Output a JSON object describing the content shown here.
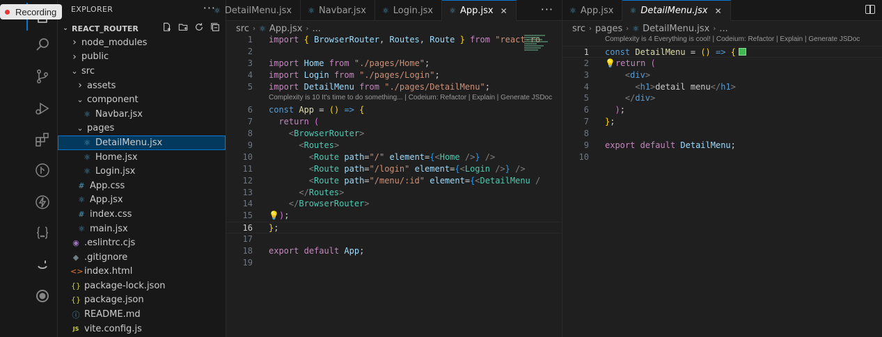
{
  "recording": {
    "label": "Recording"
  },
  "sidebar": {
    "title": "EXPLORER",
    "more": "···",
    "root": "REACT_ROUTER",
    "tree": [
      {
        "label": "node_modules",
        "kind": "folder",
        "depth": 0,
        "open": false,
        "icon": "chevron-right-icon"
      },
      {
        "label": "public",
        "kind": "folder",
        "depth": 0,
        "open": false,
        "icon": "chevron-right-icon"
      },
      {
        "label": "src",
        "kind": "folder",
        "depth": 0,
        "open": true,
        "icon": "chevron-down-icon"
      },
      {
        "label": "assets",
        "kind": "folder",
        "depth": 1,
        "open": false,
        "icon": "chevron-right-icon"
      },
      {
        "label": "component",
        "kind": "folder",
        "depth": 1,
        "open": true,
        "icon": "chevron-down-icon"
      },
      {
        "label": "Navbar.jsx",
        "kind": "file",
        "depth": 2,
        "icon": "react-icon"
      },
      {
        "label": "pages",
        "kind": "folder",
        "depth": 1,
        "open": true,
        "icon": "chevron-down-icon"
      },
      {
        "label": "DetailMenu.jsx",
        "kind": "file",
        "depth": 2,
        "icon": "react-icon",
        "selected": true
      },
      {
        "label": "Home.jsx",
        "kind": "file",
        "depth": 2,
        "icon": "react-icon"
      },
      {
        "label": "Login.jsx",
        "kind": "file",
        "depth": 2,
        "icon": "react-icon"
      },
      {
        "label": "App.css",
        "kind": "file",
        "depth": 1,
        "icon": "css-hash-icon"
      },
      {
        "label": "App.jsx",
        "kind": "file",
        "depth": 1,
        "icon": "react-icon"
      },
      {
        "label": "index.css",
        "kind": "file",
        "depth": 1,
        "icon": "css-hash-icon"
      },
      {
        "label": "main.jsx",
        "kind": "file",
        "depth": 1,
        "icon": "react-icon"
      },
      {
        "label": ".eslintrc.cjs",
        "kind": "file",
        "depth": 0,
        "icon": "eslint-icon"
      },
      {
        "label": ".gitignore",
        "kind": "file",
        "depth": 0,
        "icon": "git-icon"
      },
      {
        "label": "index.html",
        "kind": "file",
        "depth": 0,
        "icon": "html-icon"
      },
      {
        "label": "package-lock.json",
        "kind": "file",
        "depth": 0,
        "icon": "json-icon"
      },
      {
        "label": "package.json",
        "kind": "file",
        "depth": 0,
        "icon": "json-icon"
      },
      {
        "label": "README.md",
        "kind": "file",
        "depth": 0,
        "icon": "info-icon"
      },
      {
        "label": "vite.config.js",
        "kind": "file",
        "depth": 0,
        "icon": "js-icon"
      }
    ]
  },
  "editor_left": {
    "tabs": [
      {
        "label": "DetailMenu.jsx",
        "active": false
      },
      {
        "label": "Navbar.jsx",
        "active": false
      },
      {
        "label": "Login.jsx",
        "active": false
      },
      {
        "label": "App.jsx",
        "active": true,
        "close": "✕"
      }
    ],
    "more": "···",
    "breadcrumb": [
      "src",
      "App.jsx",
      "..."
    ],
    "lens": "Complexity is 10 It's time to do something... | Codeium: Refactor | Explain | Generate JSDoc",
    "current_line": 16
  },
  "editor_right": {
    "tabs": [
      {
        "label": "App.jsx",
        "active": false
      },
      {
        "label": "DetailMenu.jsx",
        "active": true,
        "close": "✕"
      }
    ],
    "breadcrumb": [
      "src",
      "pages",
      "DetailMenu.jsx",
      "..."
    ],
    "lens": "Complexity is 4 Everything is cool! | Codeium: Refactor | Explain | Generate JSDoc",
    "current_line": 1
  },
  "colors": {
    "accent": "#0078d4",
    "editor_bg": "#1f1f1f",
    "sidebar_bg": "#181818",
    "recording_dot": "#e53935"
  }
}
